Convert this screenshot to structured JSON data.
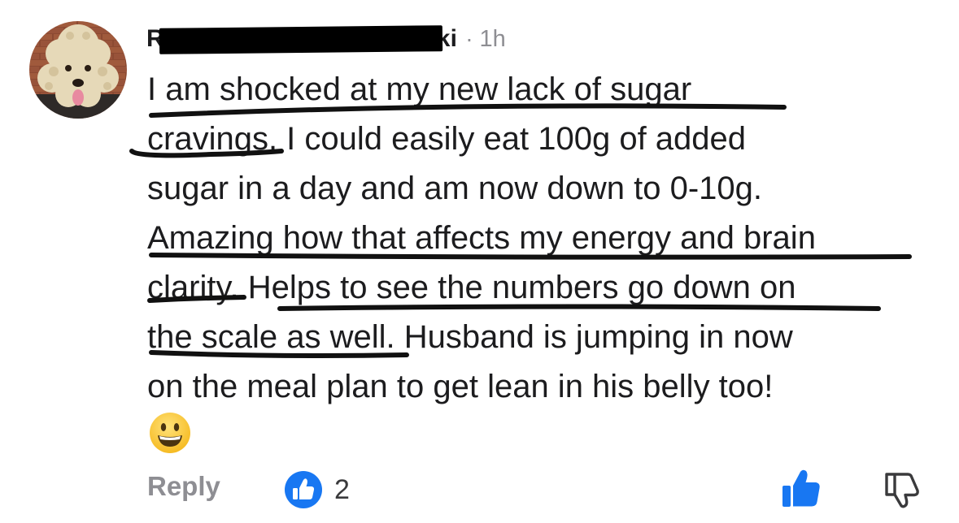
{
  "comment": {
    "author_name_start": "R",
    "author_name_end": "cki",
    "separator": "·",
    "timestamp": "1h",
    "text_lines": [
      "I am shocked at my new lack of sugar",
      "cravings. I could easily eat 100g of added",
      "sugar in a day and am now down to 0-10g.",
      "Amazing how that affects my energy and brain",
      "clarity. Helps to see the numbers go down on",
      "the scale as well. Husband is jumping in now",
      "on the meal plan to get lean in his belly too!"
    ],
    "emoji": "grinning-face"
  },
  "actions": {
    "reply_label": "Reply",
    "like_count": "2"
  },
  "colors": {
    "like_blue": "#1877f2",
    "muted_gray": "#8e8e93",
    "text": "#1c1c1e"
  },
  "icons": [
    "avatar-dog-photo",
    "like-reaction-icon",
    "thumbs-up-icon",
    "thumbs-down-icon",
    "grinning-face-emoji"
  ]
}
